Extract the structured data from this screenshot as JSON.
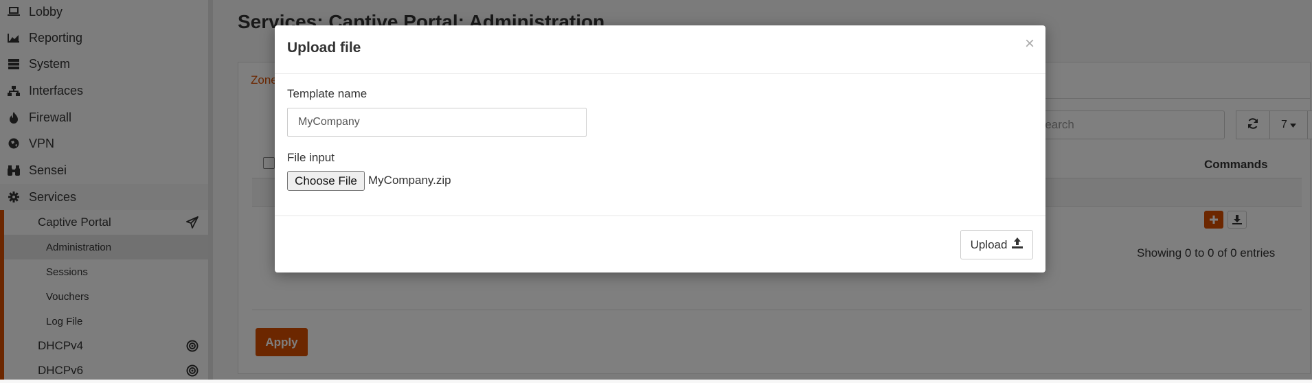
{
  "sidebar": {
    "items": [
      {
        "label": "Lobby",
        "icon": "laptop-icon"
      },
      {
        "label": "Reporting",
        "icon": "area-chart-icon"
      },
      {
        "label": "System",
        "icon": "server-icon"
      },
      {
        "label": "Interfaces",
        "icon": "sitemap-icon"
      },
      {
        "label": "Firewall",
        "icon": "fire-icon"
      },
      {
        "label": "VPN",
        "icon": "globe-icon"
      },
      {
        "label": "Sensei",
        "icon": "binoculars-icon"
      },
      {
        "label": "Services",
        "icon": "cog-icon"
      }
    ],
    "sub": {
      "captive_portal": "Captive Portal",
      "administration": "Administration",
      "sessions": "Sessions",
      "vouchers": "Vouchers",
      "log_file": "Log File",
      "dhcpv4": "DHCPv4",
      "dhcpv6": "DHCPv6"
    }
  },
  "main": {
    "title": "Services: Captive Portal: Administration",
    "tab": "Zones",
    "search_placeholder": "Search",
    "page_size": "7",
    "column_commands": "Commands",
    "showing": "Showing 0 to 0 of 0 entries",
    "apply": "Apply"
  },
  "modal": {
    "title": "Upload file",
    "close": "×",
    "template_name_label": "Template name",
    "template_name_value": "MyCompany",
    "file_input_label": "File input",
    "choose_file": "Choose File",
    "file_name": "MyCompany.zip",
    "upload": "Upload"
  },
  "colors": {
    "accent": "#d94f00"
  }
}
